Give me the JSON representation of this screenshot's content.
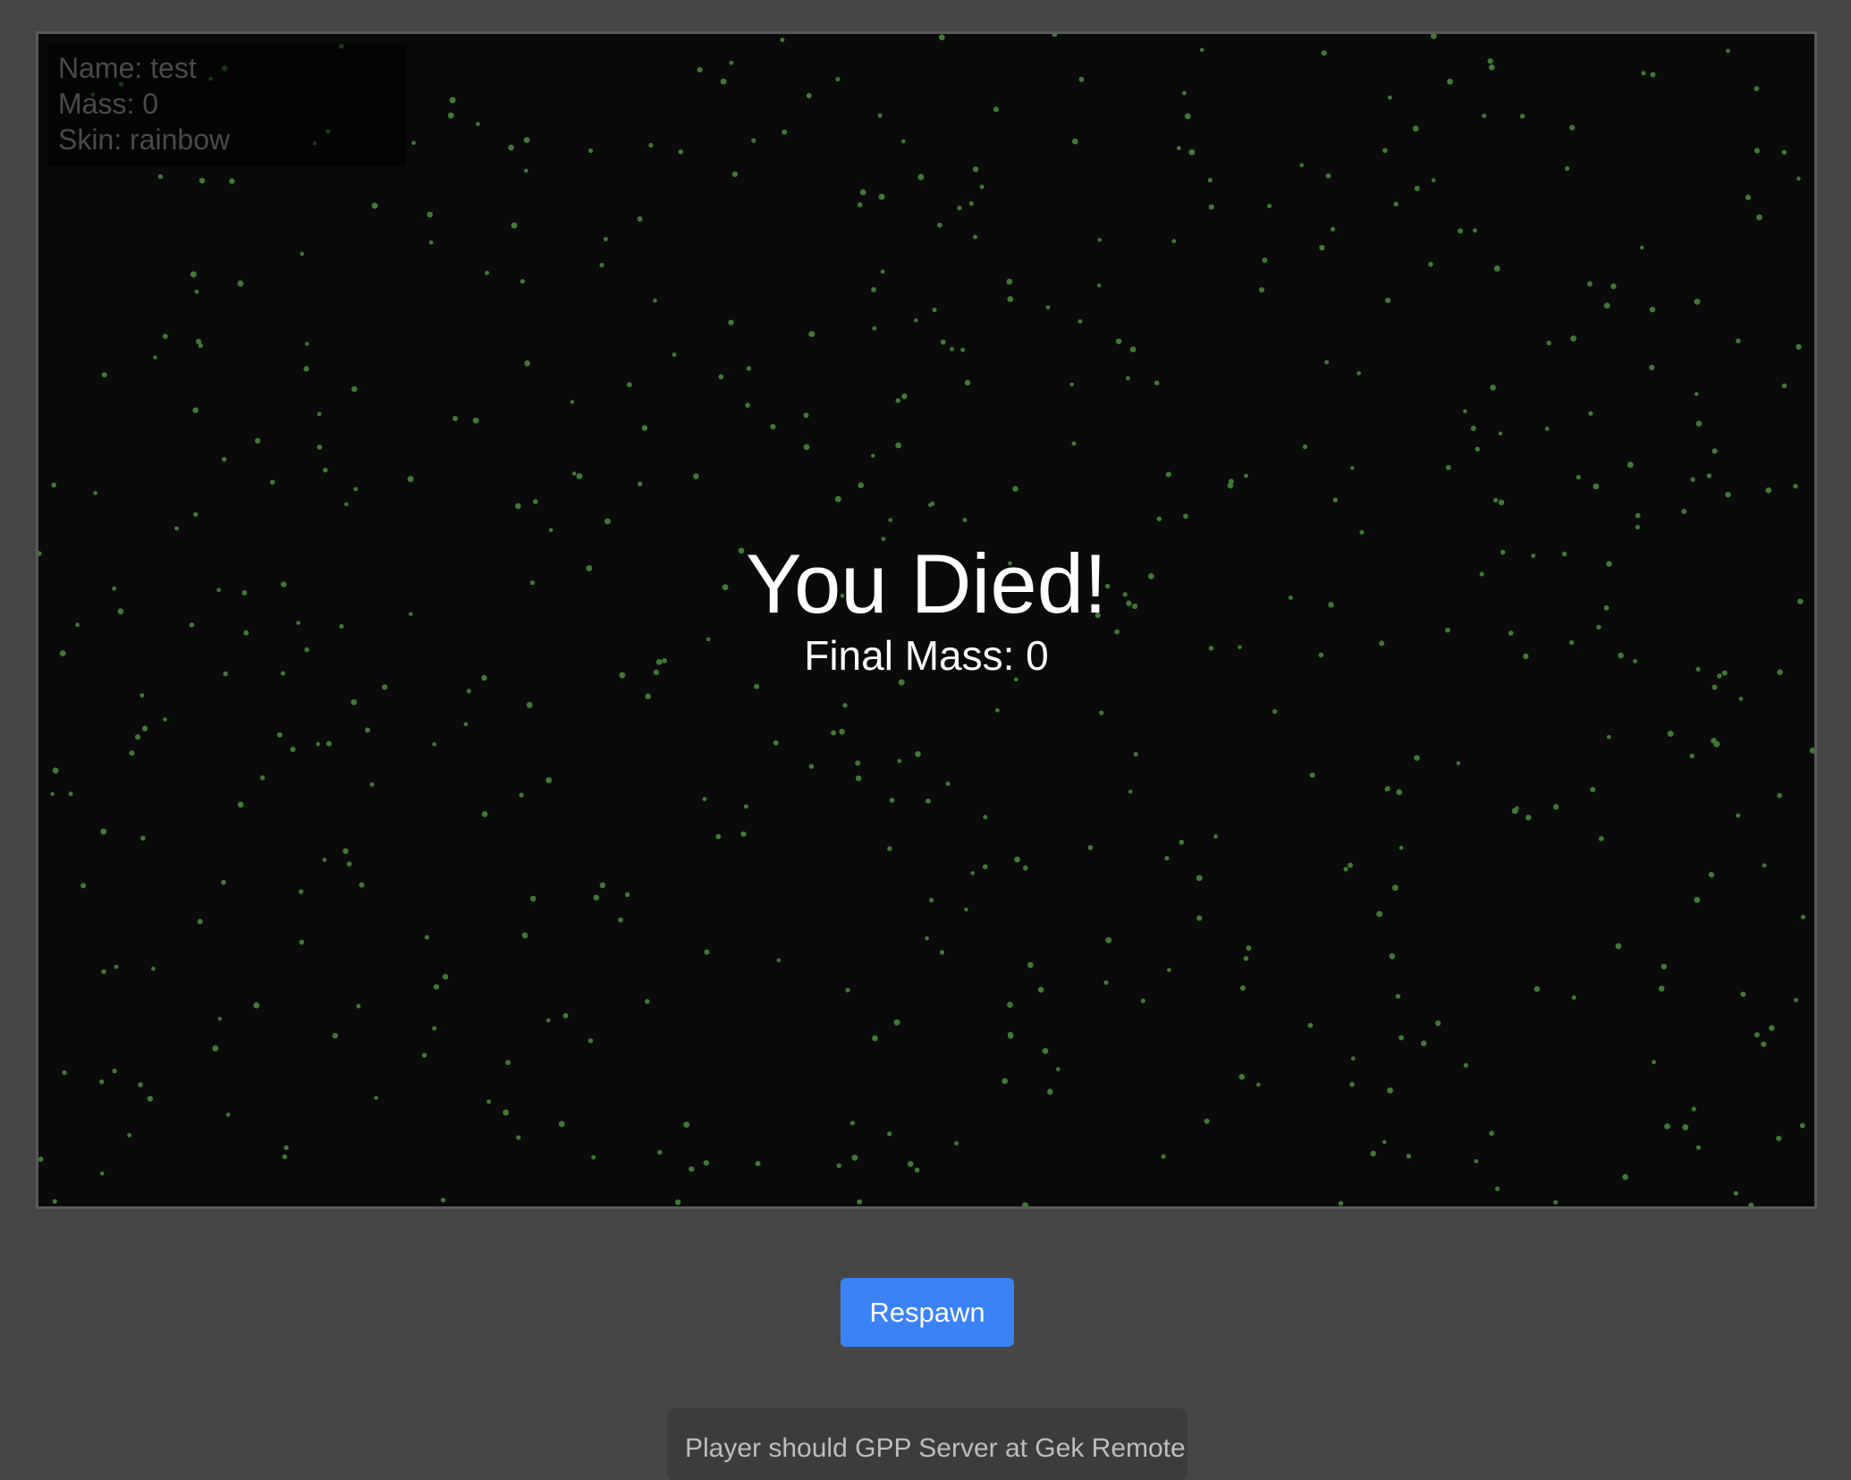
{
  "hud": {
    "name_line": "Name: test",
    "mass_line": "Mass: 0",
    "skin_line": "Skin: rainbow"
  },
  "death_screen": {
    "title": "You Died!",
    "final_mass": "Final Mass: 0"
  },
  "controls": {
    "respawn_label": "Respawn"
  },
  "info_panel": {
    "text": "Player should GPP Server at Gek Remote..."
  },
  "colors": {
    "page_background": "#464646",
    "canvas_background": "#0a0a0a",
    "food_pellet": "#3f7a33",
    "button_accent": "#3b82f6"
  }
}
